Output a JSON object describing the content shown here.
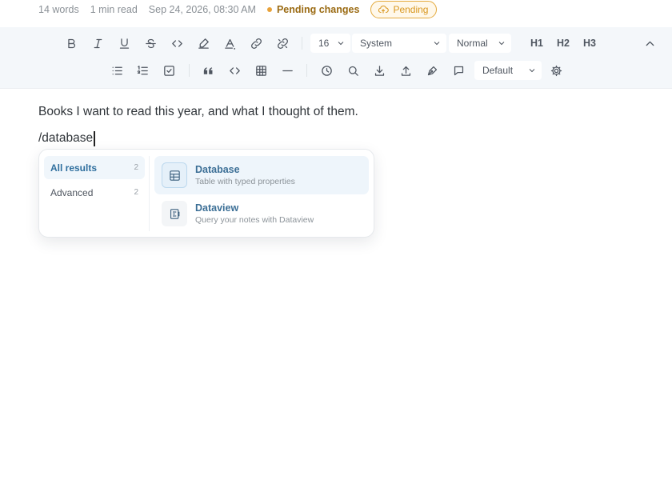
{
  "status": {
    "words": "14 words",
    "read_time": "1 min read",
    "timestamp": "Sep 24, 2026, 08:30 AM",
    "pending_changes": "Pending changes",
    "badge": "Pending"
  },
  "toolbar": {
    "font_size": "16",
    "font_family": "System",
    "line_style": "Normal",
    "h1": "H1",
    "h2": "H2",
    "h3": "H3",
    "theme": "Default"
  },
  "editor": {
    "paragraph": "Books I want to read this year, and what I thought of them.",
    "command": "/database"
  },
  "slash_menu": {
    "categories": [
      {
        "label": "All results",
        "count": "2"
      },
      {
        "label": "Advanced",
        "count": "2"
      }
    ],
    "options": [
      {
        "title": "Database",
        "subtitle": "Table with typed properties",
        "icon": "table-icon"
      },
      {
        "title": "Dataview",
        "subtitle": "Query your notes with Dataview",
        "icon": "dataview-icon"
      }
    ]
  }
}
